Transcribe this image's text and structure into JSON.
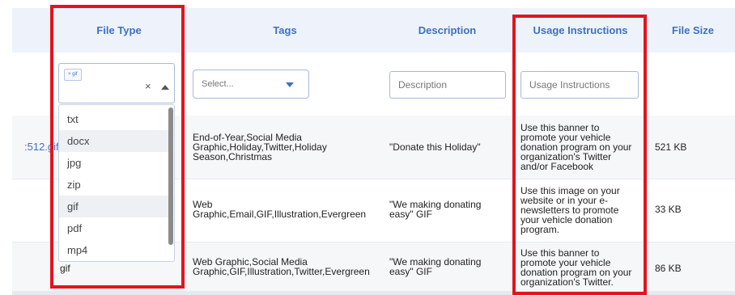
{
  "columns": {
    "file_type": "File Type",
    "tags": "Tags",
    "description": "Description",
    "usage": "Usage Instructions",
    "file_size": "File Size"
  },
  "filters": {
    "file_type_chip": "× gif",
    "tags_placeholder": "Select...",
    "description_placeholder": "Description",
    "usage_placeholder": "Usage Instructions"
  },
  "dropdown_options": [
    "txt",
    "docx",
    "jpg",
    "zip",
    "gif",
    "pdf",
    "mp4"
  ],
  "rows": [
    {
      "filename": ":512.gif",
      "file_type": "",
      "tags": [
        "End-of-Year,Social Media",
        "Graphic,Holiday,Twitter,Holiday",
        "Season,Christmas"
      ],
      "description": [
        "\"Donate this Holiday\""
      ],
      "usage": [
        "Use this banner to",
        "promote your vehicle",
        "donation program on your",
        "organization's Twitter",
        "and/or Facebook"
      ],
      "size": "521 KB"
    },
    {
      "filename": "",
      "file_type": "",
      "tags": [
        "Web",
        "Graphic,Email,GIF,Illustration,Evergreen"
      ],
      "description": [
        "\"We making donating",
        "easy\" GIF"
      ],
      "usage": [
        "Use this image on your",
        "website or in your e-",
        "newsletters to promote",
        "your vehicle donation",
        "program."
      ],
      "size": "33 KB"
    },
    {
      "filename": "",
      "file_type": "gif",
      "tags": [
        "Web Graphic,Social Media",
        "Graphic,GIF,Illustration,Twitter,Evergreen"
      ],
      "description": [
        "\"We making donating",
        "easy\" GIF"
      ],
      "usage": [
        "Use this banner to",
        "promote your vehicle",
        "donation program on your",
        "organization's Twitter."
      ],
      "size": "86 KB"
    }
  ],
  "colors": {
    "header_bg": "#eef3fb",
    "header_text": "#3f6fc4",
    "filename_link": "#3f6fc4",
    "highlight_border": "#e1141f"
  }
}
